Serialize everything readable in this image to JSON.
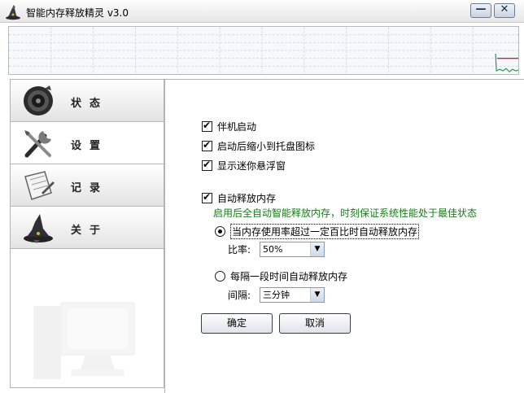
{
  "window": {
    "title": "智能内存释放精灵 v3.0",
    "minimize_label": "—",
    "close_label": "✕"
  },
  "sidebar": {
    "items": [
      {
        "label": "状态",
        "icon": "speaker-icon"
      },
      {
        "label": "设置",
        "icon": "tools-icon"
      },
      {
        "label": "记录",
        "icon": "notebook-icon"
      },
      {
        "label": "关于",
        "icon": "wizard-icon"
      }
    ],
    "active_index": 1
  },
  "settings": {
    "startup": {
      "label": "伴机启动",
      "checked": true
    },
    "minimize_to_tray": {
      "label": "启动后缩小到托盘图标",
      "checked": true
    },
    "show_float": {
      "label": "显示迷你悬浮窗",
      "checked": true
    },
    "auto_release": {
      "label": "自动释放内存",
      "checked": true
    },
    "hint": "启用后全自动智能释放内存，时刻保证系统性能处于最佳状态",
    "mode_ratio": {
      "label": "当内存使用率超过一定百比时自动释放内存",
      "selected": true
    },
    "ratio_label": "比率:",
    "ratio_value": "50%",
    "mode_interval": {
      "label": "每隔一段时间自动释放内存",
      "selected": false
    },
    "interval_label": "间隔:",
    "interval_value": "三分钟",
    "ok_label": "确定",
    "cancel_label": "取消"
  },
  "colors": {
    "hint_green": "#1a7a1a",
    "graph_line": "#2f8f4f",
    "graph_marker": "#cc2222"
  }
}
